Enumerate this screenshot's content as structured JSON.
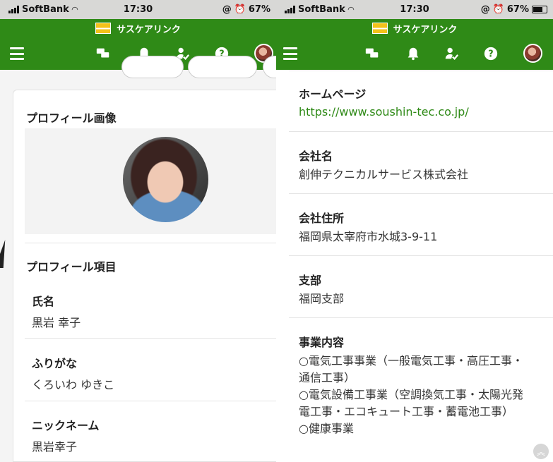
{
  "status": {
    "carrier": "SoftBank",
    "time": "17:30",
    "battery": "67%"
  },
  "brand": {
    "name": "サスケアリンク"
  },
  "nav": {
    "icons": [
      "menu-icon",
      "chat-icon",
      "bell-icon",
      "user-check-icon",
      "help-icon",
      "avatar"
    ]
  },
  "left": {
    "profile_image_title": "プロフィール画像",
    "profile_items_title": "プロフィール項目",
    "fields": [
      {
        "label": "氏名",
        "value": "黒岩 幸子"
      },
      {
        "label": "ふりがな",
        "value": "くろいわ ゆきこ"
      },
      {
        "label": "ニックネーム",
        "value": "黒岩幸子"
      }
    ]
  },
  "right": {
    "rows": [
      {
        "label": "ホームページ",
        "value": "https://www.soushin-tec.co.jp/"
      },
      {
        "label": "会社名",
        "value": "創伸テクニカルサービス株式会社"
      },
      {
        "label": "会社住所",
        "value": "福岡県太宰府市水城3-9-11"
      },
      {
        "label": "支部",
        "value": "福岡支部"
      },
      {
        "label": "事業内容",
        "value_lines": [
          "○電気工事事業（一般電気工事・高圧工事・",
          "通信工事）",
          "○電気設備工事業（空調換気工事・太陽光発",
          "電工事・エコキュート工事・蓄電池工事）",
          "○健康事業"
        ]
      }
    ]
  },
  "colors": {
    "brand_green": "#2f8a17",
    "link": "#2f8a17"
  }
}
